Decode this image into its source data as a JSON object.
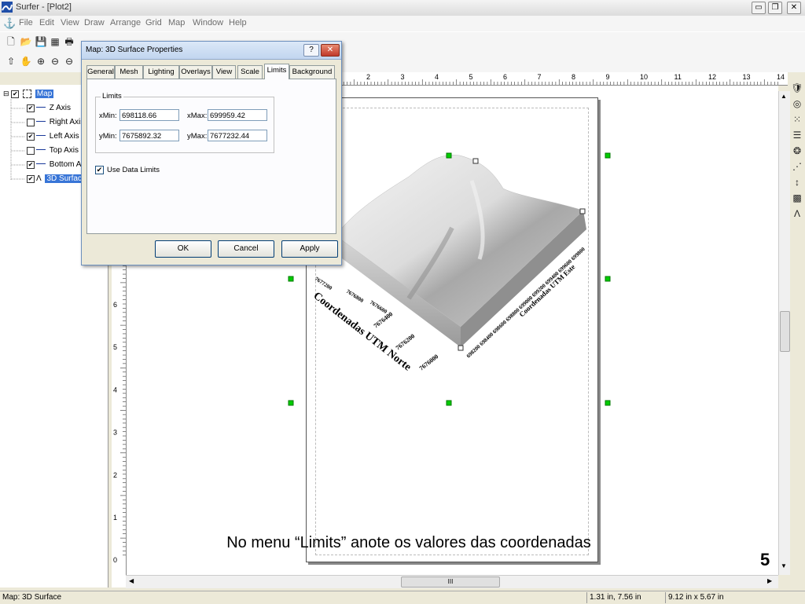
{
  "window": {
    "title": "Surfer - [Plot2]",
    "controls": {
      "minimize": "▭",
      "restore": "❐",
      "close": "✕"
    },
    "mdi_controls": {
      "minimize": "_",
      "restore": "▫",
      "close": "✕"
    }
  },
  "menu": [
    "File",
    "Edit",
    "View",
    "Draw",
    "Arrange",
    "Grid",
    "Map",
    "Window",
    "Help"
  ],
  "toolbar1": [
    {
      "icon": "new-file-icon",
      "glyph": "🗋"
    },
    {
      "icon": "open-folder-icon",
      "glyph": "📂"
    },
    {
      "icon": "save-icon",
      "glyph": "💾"
    },
    {
      "icon": "worksheet-icon",
      "glyph": "▦"
    },
    {
      "icon": "print-icon",
      "glyph": "🖶"
    }
  ],
  "toolbar2": [
    {
      "icon": "arrow-select-icon",
      "glyph": "⇧"
    },
    {
      "icon": "pan-hand-icon",
      "glyph": "✋"
    },
    {
      "icon": "zoom-in-icon",
      "glyph": "⊕"
    },
    {
      "icon": "zoom-out-icon",
      "glyph": "⊖"
    },
    {
      "icon": "zoom-fit-icon",
      "glyph": "⊖"
    }
  ],
  "tree": {
    "items": [
      {
        "label": "Map",
        "checked": true,
        "selected": true
      },
      {
        "label": "Z Axis",
        "checked": true
      },
      {
        "label": "Right Axis",
        "checked": false
      },
      {
        "label": "Left Axis",
        "checked": true
      },
      {
        "label": "Top Axis",
        "checked": false
      },
      {
        "label": "Bottom A",
        "checked": true
      },
      {
        "label": "3D Surfac",
        "checked": true,
        "selected": true
      }
    ]
  },
  "ruler_top_ticks": [
    "2",
    "3",
    "4",
    "5",
    "6",
    "7",
    "8",
    "9",
    "10",
    "11",
    "12",
    "13",
    "14"
  ],
  "ruler_left_ticks": [
    "6",
    "5",
    "4",
    "3",
    "2",
    "1",
    "0"
  ],
  "dialog": {
    "title": "Map: 3D Surface Properties",
    "help": "?",
    "close": "✕",
    "tabs": [
      "General",
      "Mesh",
      "Lighting",
      "Overlays",
      "View",
      "Scale",
      "Limits",
      "Background"
    ],
    "active_tab": "Limits",
    "limits": {
      "legend": "Limits",
      "xmin_label": "xMin:",
      "xmin": "698118.66",
      "xmax_label": "xMax:",
      "xmax": "699959.42",
      "ymin_label": "yMin:",
      "ymin": "7675892.32",
      "ymax_label": "yMax:",
      "ymax": "7677232.44"
    },
    "use_data_limits": {
      "label": "Use Data Limits",
      "checked": true,
      "mark": "✔"
    },
    "buttons": {
      "ok": "OK",
      "cancel": "Cancel",
      "apply": "Apply"
    }
  },
  "map_labels": {
    "y_ticks": [
      "7677200",
      "7676800",
      "7676600",
      "7676400",
      "7676200",
      "7676000"
    ],
    "y_title": "Coordenadas UTM Norte",
    "x_ticks": "698200 698400 698600 698800 699000 699200 699400 699600 699800",
    "x_title": "Coordenadas UTM Este"
  },
  "right_tools": [
    {
      "icon": "tool-1-icon",
      "glyph": "🛡"
    },
    {
      "icon": "tool-2-icon",
      "glyph": "◎"
    },
    {
      "icon": "tool-3-icon",
      "glyph": "⁙"
    },
    {
      "icon": "tool-4-icon",
      "glyph": "☰"
    },
    {
      "icon": "tool-5-icon",
      "glyph": "❂"
    },
    {
      "icon": "tool-6-icon",
      "glyph": "⋰"
    },
    {
      "icon": "tool-7-icon",
      "glyph": "↕"
    },
    {
      "icon": "tool-8-icon",
      "glyph": "▩"
    },
    {
      "icon": "tool-9-icon",
      "glyph": "Λ"
    }
  ],
  "hscroll_thumb": "III",
  "status": {
    "left": "Map: 3D Surface",
    "position": "1.31 in, 7.56 in",
    "size": "9.12 in x 5.67 in"
  },
  "caption": "No menu “Limits” anote os valores das coordenadas",
  "page_number": "5"
}
